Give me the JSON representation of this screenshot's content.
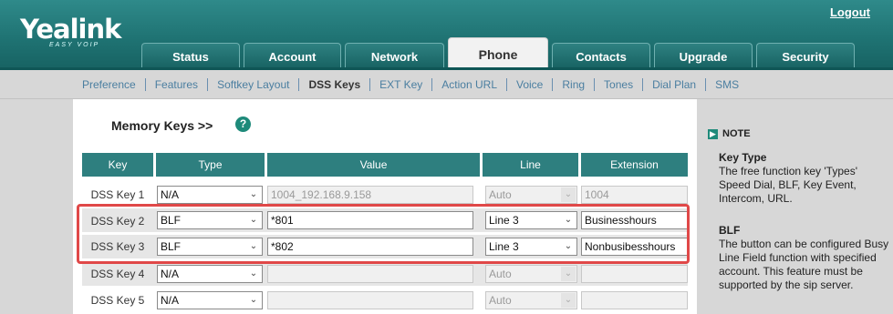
{
  "header": {
    "logo_text": "Yealink",
    "logo_subtext": "EASY VOIP",
    "logout": "Logout",
    "tabs": [
      {
        "label": "Status"
      },
      {
        "label": "Account"
      },
      {
        "label": "Network"
      },
      {
        "label": "Phone",
        "active": true
      },
      {
        "label": "Contacts"
      },
      {
        "label": "Upgrade"
      },
      {
        "label": "Security"
      }
    ]
  },
  "subnav": {
    "items": [
      "Preference",
      "Features",
      "Softkey Layout",
      "DSS Keys",
      "EXT Key",
      "Action URL",
      "Voice",
      "Ring",
      "Tones",
      "Dial Plan",
      "SMS"
    ],
    "active": "DSS Keys"
  },
  "main": {
    "section_title": "Memory Keys >>",
    "help_icon": "?",
    "columns": [
      "Key",
      "Type",
      "Value",
      "Line",
      "Extension"
    ],
    "rows": [
      {
        "key": "DSS Key 1",
        "type": "N/A",
        "value": "1004_192.168.9.158",
        "line": "Auto",
        "extension": "1004",
        "enabled": false
      },
      {
        "key": "DSS Key 2",
        "type": "BLF",
        "value": "*801",
        "line": "Line 3",
        "extension": "Businesshours",
        "enabled": true
      },
      {
        "key": "DSS Key 3",
        "type": "BLF",
        "value": "*802",
        "line": "Line 3",
        "extension": "Nonbusibesshours",
        "enabled": true
      },
      {
        "key": "DSS Key 4",
        "type": "N/A",
        "value": "",
        "line": "Auto",
        "extension": "",
        "enabled": false
      },
      {
        "key": "DSS Key 5",
        "type": "N/A",
        "value": "",
        "line": "Auto",
        "extension": "",
        "enabled": false
      }
    ],
    "highlight_color": "#e04848"
  },
  "note": {
    "heading": "NOTE",
    "sections": [
      {
        "title": "Key Type",
        "text": "The free function key 'Types' Speed Dial, BLF, Key Event, Intercom, URL."
      },
      {
        "title": "BLF",
        "text": "The button can be configured Busy Line Field function with specified account. This feature must be supported by the sip server."
      }
    ]
  },
  "colors": {
    "header_teal": "#1f7373",
    "table_header": "#2e7f7f",
    "link_blue": "#4a7ea0"
  }
}
